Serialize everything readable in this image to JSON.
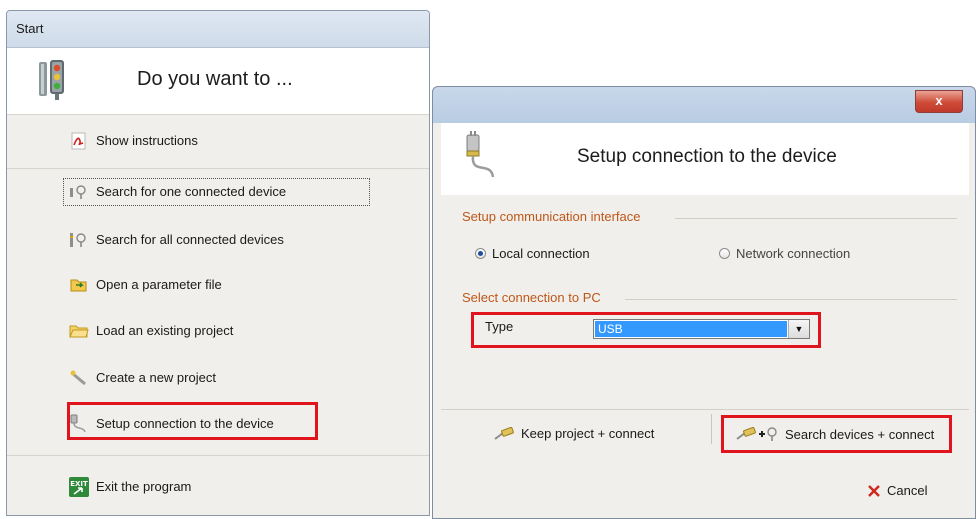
{
  "start_window": {
    "title": "Start",
    "header": "Do you want to ...",
    "items": [
      {
        "label": "Show instructions",
        "icon": "pdf-icon"
      },
      {
        "label": "Search for one connected device",
        "icon": "search-device-icon"
      },
      {
        "label": "Search for all connected devices",
        "icon": "search-devices-icon"
      },
      {
        "label": "Open a parameter file",
        "icon": "open-file-icon"
      },
      {
        "label": "Load an existing project",
        "icon": "folder-icon"
      },
      {
        "label": "Create a new project",
        "icon": "wand-icon"
      },
      {
        "label": "Setup connection to the device",
        "icon": "plug-icon"
      },
      {
        "label": "Exit the program",
        "icon": "exit-icon"
      }
    ],
    "exit_icon_text": "EXIT"
  },
  "connection_dialog": {
    "close_label": "x",
    "title": "Setup connection to the device",
    "communication_group": "Setup communication interface",
    "local_connection": "Local connection",
    "network_connection": "Network connection",
    "selected_interface": "local",
    "pc_group": "Select connection to PC",
    "type_label": "Type",
    "type_value": "USB",
    "keep_project": "Keep project + connect",
    "search_devices": "Search devices + connect",
    "cancel": "Cancel"
  },
  "colors": {
    "highlight_box": "#e0141c",
    "group_label": "#c0571a",
    "selection": "#3399ff",
    "cancel_x": "#d0261c"
  }
}
